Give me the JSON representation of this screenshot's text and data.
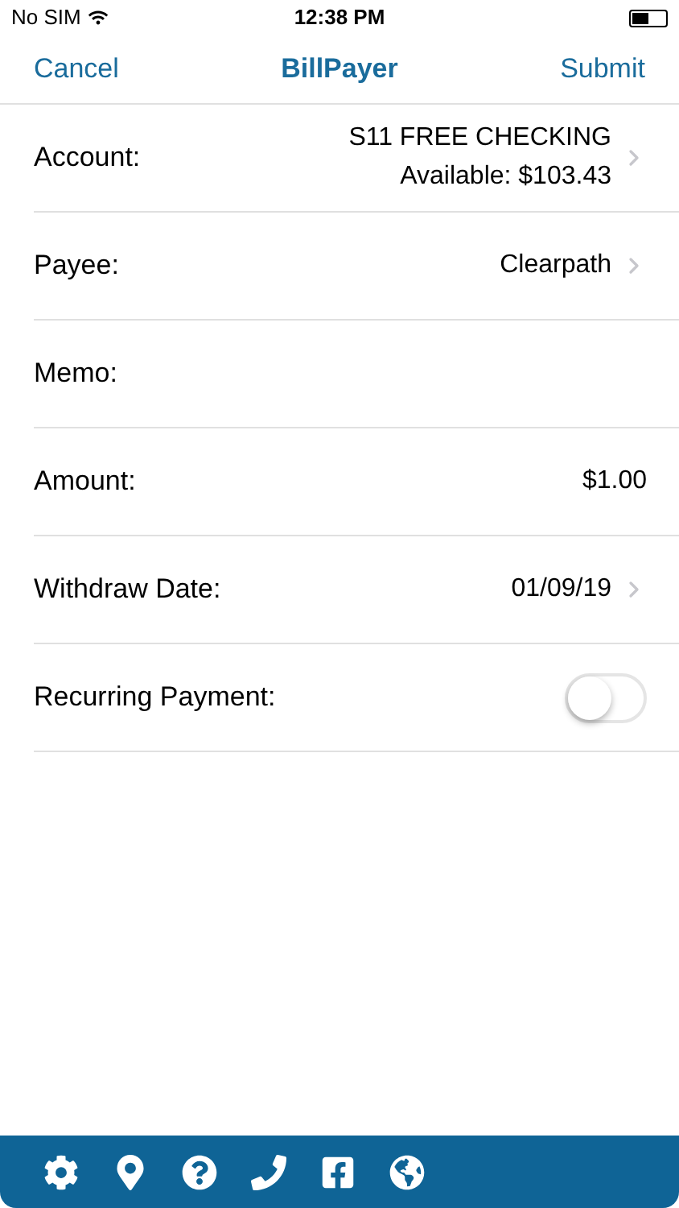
{
  "status_bar": {
    "carrier": "No SIM",
    "time": "12:38 PM"
  },
  "nav": {
    "left": "Cancel",
    "title": "BillPayer",
    "right": "Submit"
  },
  "rows": [
    {
      "kind": "disclosure",
      "label": "Account:",
      "value": "S11 FREE CHECKING",
      "detail": "Available: $103.43"
    },
    {
      "kind": "disclosure",
      "label": "Payee:",
      "value": "Clearpath"
    },
    {
      "kind": "field",
      "label": "Memo:"
    },
    {
      "kind": "field",
      "label": "Amount:",
      "value": "$1.00"
    },
    {
      "kind": "disclosure",
      "label": "Withdraw Date:",
      "value": "01/09/19"
    },
    {
      "kind": "toggle",
      "label": "Recurring Payment:",
      "on": false
    }
  ]
}
